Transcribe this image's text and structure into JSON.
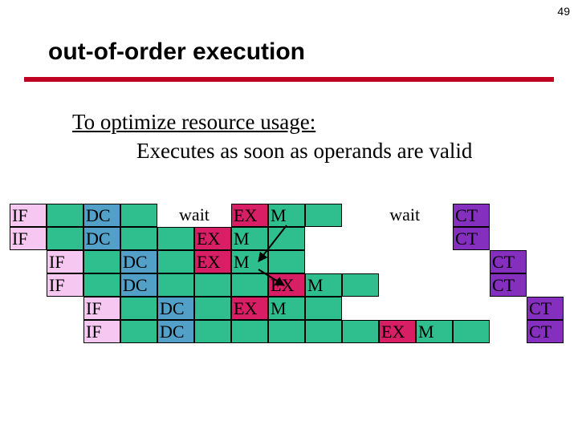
{
  "page_number": "49",
  "title": "out-of-order execution",
  "body_line1": "To optimize resource usage:",
  "body_line2": "Executes as soon as operands are valid",
  "labels": {
    "IF": "IF",
    "DC": "DC",
    "EX": "EX",
    "M": "M",
    "CT": "CT",
    "wait": "wait"
  }
}
